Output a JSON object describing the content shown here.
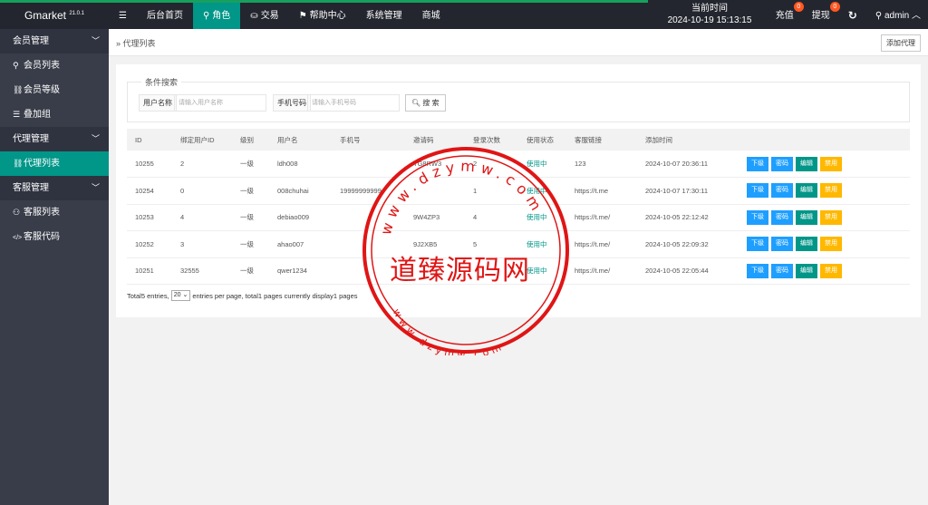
{
  "topbar": {
    "logo": "Gmarket",
    "version": "21.0.1",
    "nav": [
      {
        "icon": "menu-icon",
        "glyph": "☰",
        "label": ""
      },
      {
        "icon": "",
        "glyph": "",
        "label": "后台首页"
      },
      {
        "icon": "user-icon",
        "glyph": "⚲",
        "label": "角色"
      },
      {
        "icon": "transaction-icon",
        "glyph": "⛀",
        "label": "交易"
      },
      {
        "icon": "flag-icon",
        "glyph": "⚑",
        "label": "帮助中心"
      },
      {
        "icon": "",
        "glyph": "",
        "label": "系统管理"
      },
      {
        "icon": "",
        "glyph": "",
        "label": "商城"
      }
    ],
    "time_label": "当前时间",
    "time_value": "2024-10-19 15:13:15",
    "recharge_label": "充值",
    "recharge_badge": "0",
    "withdraw_label": "提现",
    "withdraw_badge": "0",
    "refresh_glyph": "↻",
    "user_label": "admin"
  },
  "sidebar": {
    "groups": [
      {
        "label": "会员管理",
        "items": [
          {
            "icon": "user-icon",
            "glyph": "⚲",
            "label": "会员列表"
          },
          {
            "icon": "link-icon",
            "glyph": "🔗",
            "label": "会员等级"
          },
          {
            "icon": "list-icon",
            "glyph": "☰",
            "label": "叠加组"
          }
        ]
      },
      {
        "label": "代理管理",
        "items": [
          {
            "icon": "link-icon",
            "glyph": "🔗",
            "label": "代理列表"
          }
        ]
      },
      {
        "label": "客服管理",
        "items": [
          {
            "icon": "users-icon",
            "glyph": "👥",
            "label": "客服列表"
          },
          {
            "icon": "code-icon",
            "glyph": "</>",
            "label": "客服代码"
          }
        ]
      }
    ]
  },
  "breadcrumb": {
    "sep": "»",
    "label": "代理列表"
  },
  "add_agent_label": "添加代理",
  "search": {
    "legend": "条件搜索",
    "username_label": "用户名称",
    "username_placeholder": "请输入用户名称",
    "phone_label": "手机号码",
    "phone_placeholder": "请输入手机号码",
    "search_button": "搜 索"
  },
  "table": {
    "headers": [
      "ID",
      "绑定用户ID",
      "级别",
      "用户名",
      "手机号",
      "邀请码",
      "登录次数",
      "使用状态",
      "客服链接",
      "添加时间",
      ""
    ],
    "rows": [
      [
        "10255",
        "2",
        "一级",
        "ldh008",
        "",
        "TG8RW3",
        "2",
        "使用中",
        "123",
        "2024-10-07 20:36:11"
      ],
      [
        "10254",
        "0",
        "一级",
        "008chuhai",
        "19999999999",
        "",
        "1",
        "使用中",
        "https://t.me",
        "2024-10-07 17:30:11"
      ],
      [
        "10253",
        "4",
        "一级",
        "debiao009",
        "",
        "9W4ZP3",
        "4",
        "使用中",
        "https://t.me/",
        "2024-10-05 22:12:42"
      ],
      [
        "10252",
        "3",
        "一级",
        "ahao007",
        "",
        "9J2XB5",
        "5",
        "使用中",
        "https://t.me/",
        "2024-10-05 22:09:32"
      ],
      [
        "10251",
        "32555",
        "一级",
        "qwer1234",
        "",
        "",
        "",
        "使用中",
        "https://t.me/",
        "2024-10-05 22:05:44"
      ]
    ],
    "actions": [
      "下级",
      "密码",
      "编辑",
      "禁用"
    ]
  },
  "pager": {
    "text1": "Total5 entries,",
    "per_page": "20",
    "text2": "entries per page, total1 pages currently display1 pages"
  },
  "stamp": {
    "text": "道臻源码网",
    "ring_top": "www.dzymw.com",
    "ring_bottom": "www.dzymw.com",
    "color": "#e01515"
  }
}
